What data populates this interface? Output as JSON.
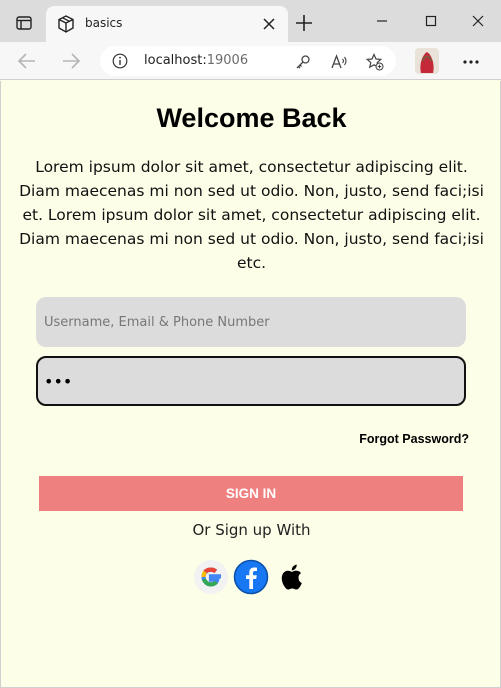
{
  "browser": {
    "tab_title": "basics",
    "address": {
      "host": "localhost:",
      "port": "19006"
    }
  },
  "page": {
    "heading": "Welcome Back",
    "blurb": "Lorem ipsum dolor sit amet, consectetur adipiscing elit. Diam maecenas mi non sed ut odio. Non, justo, send faci;isi et. Lorem ipsum dolor sit amet, consectetur adipiscing elit. Diam maecenas mi non sed ut odio. Non, justo, send faci;isi etc.",
    "username_placeholder": "Username, Email & Phone Number",
    "password_value": "•••",
    "forgot_label": "Forgot Password?",
    "signin_label": "SIGN IN",
    "alt_signup_label": "Or Sign up With",
    "social": [
      {
        "provider": "Google",
        "icon": "google-icon"
      },
      {
        "provider": "Facebook",
        "icon": "facebook-icon"
      },
      {
        "provider": "Apple",
        "icon": "apple-icon"
      }
    ]
  },
  "colors": {
    "page_bg": "#fdfee8",
    "field_bg": "#dcdcdc",
    "signin_bg": "#ef8080",
    "facebook_blue": "#1877f2"
  }
}
